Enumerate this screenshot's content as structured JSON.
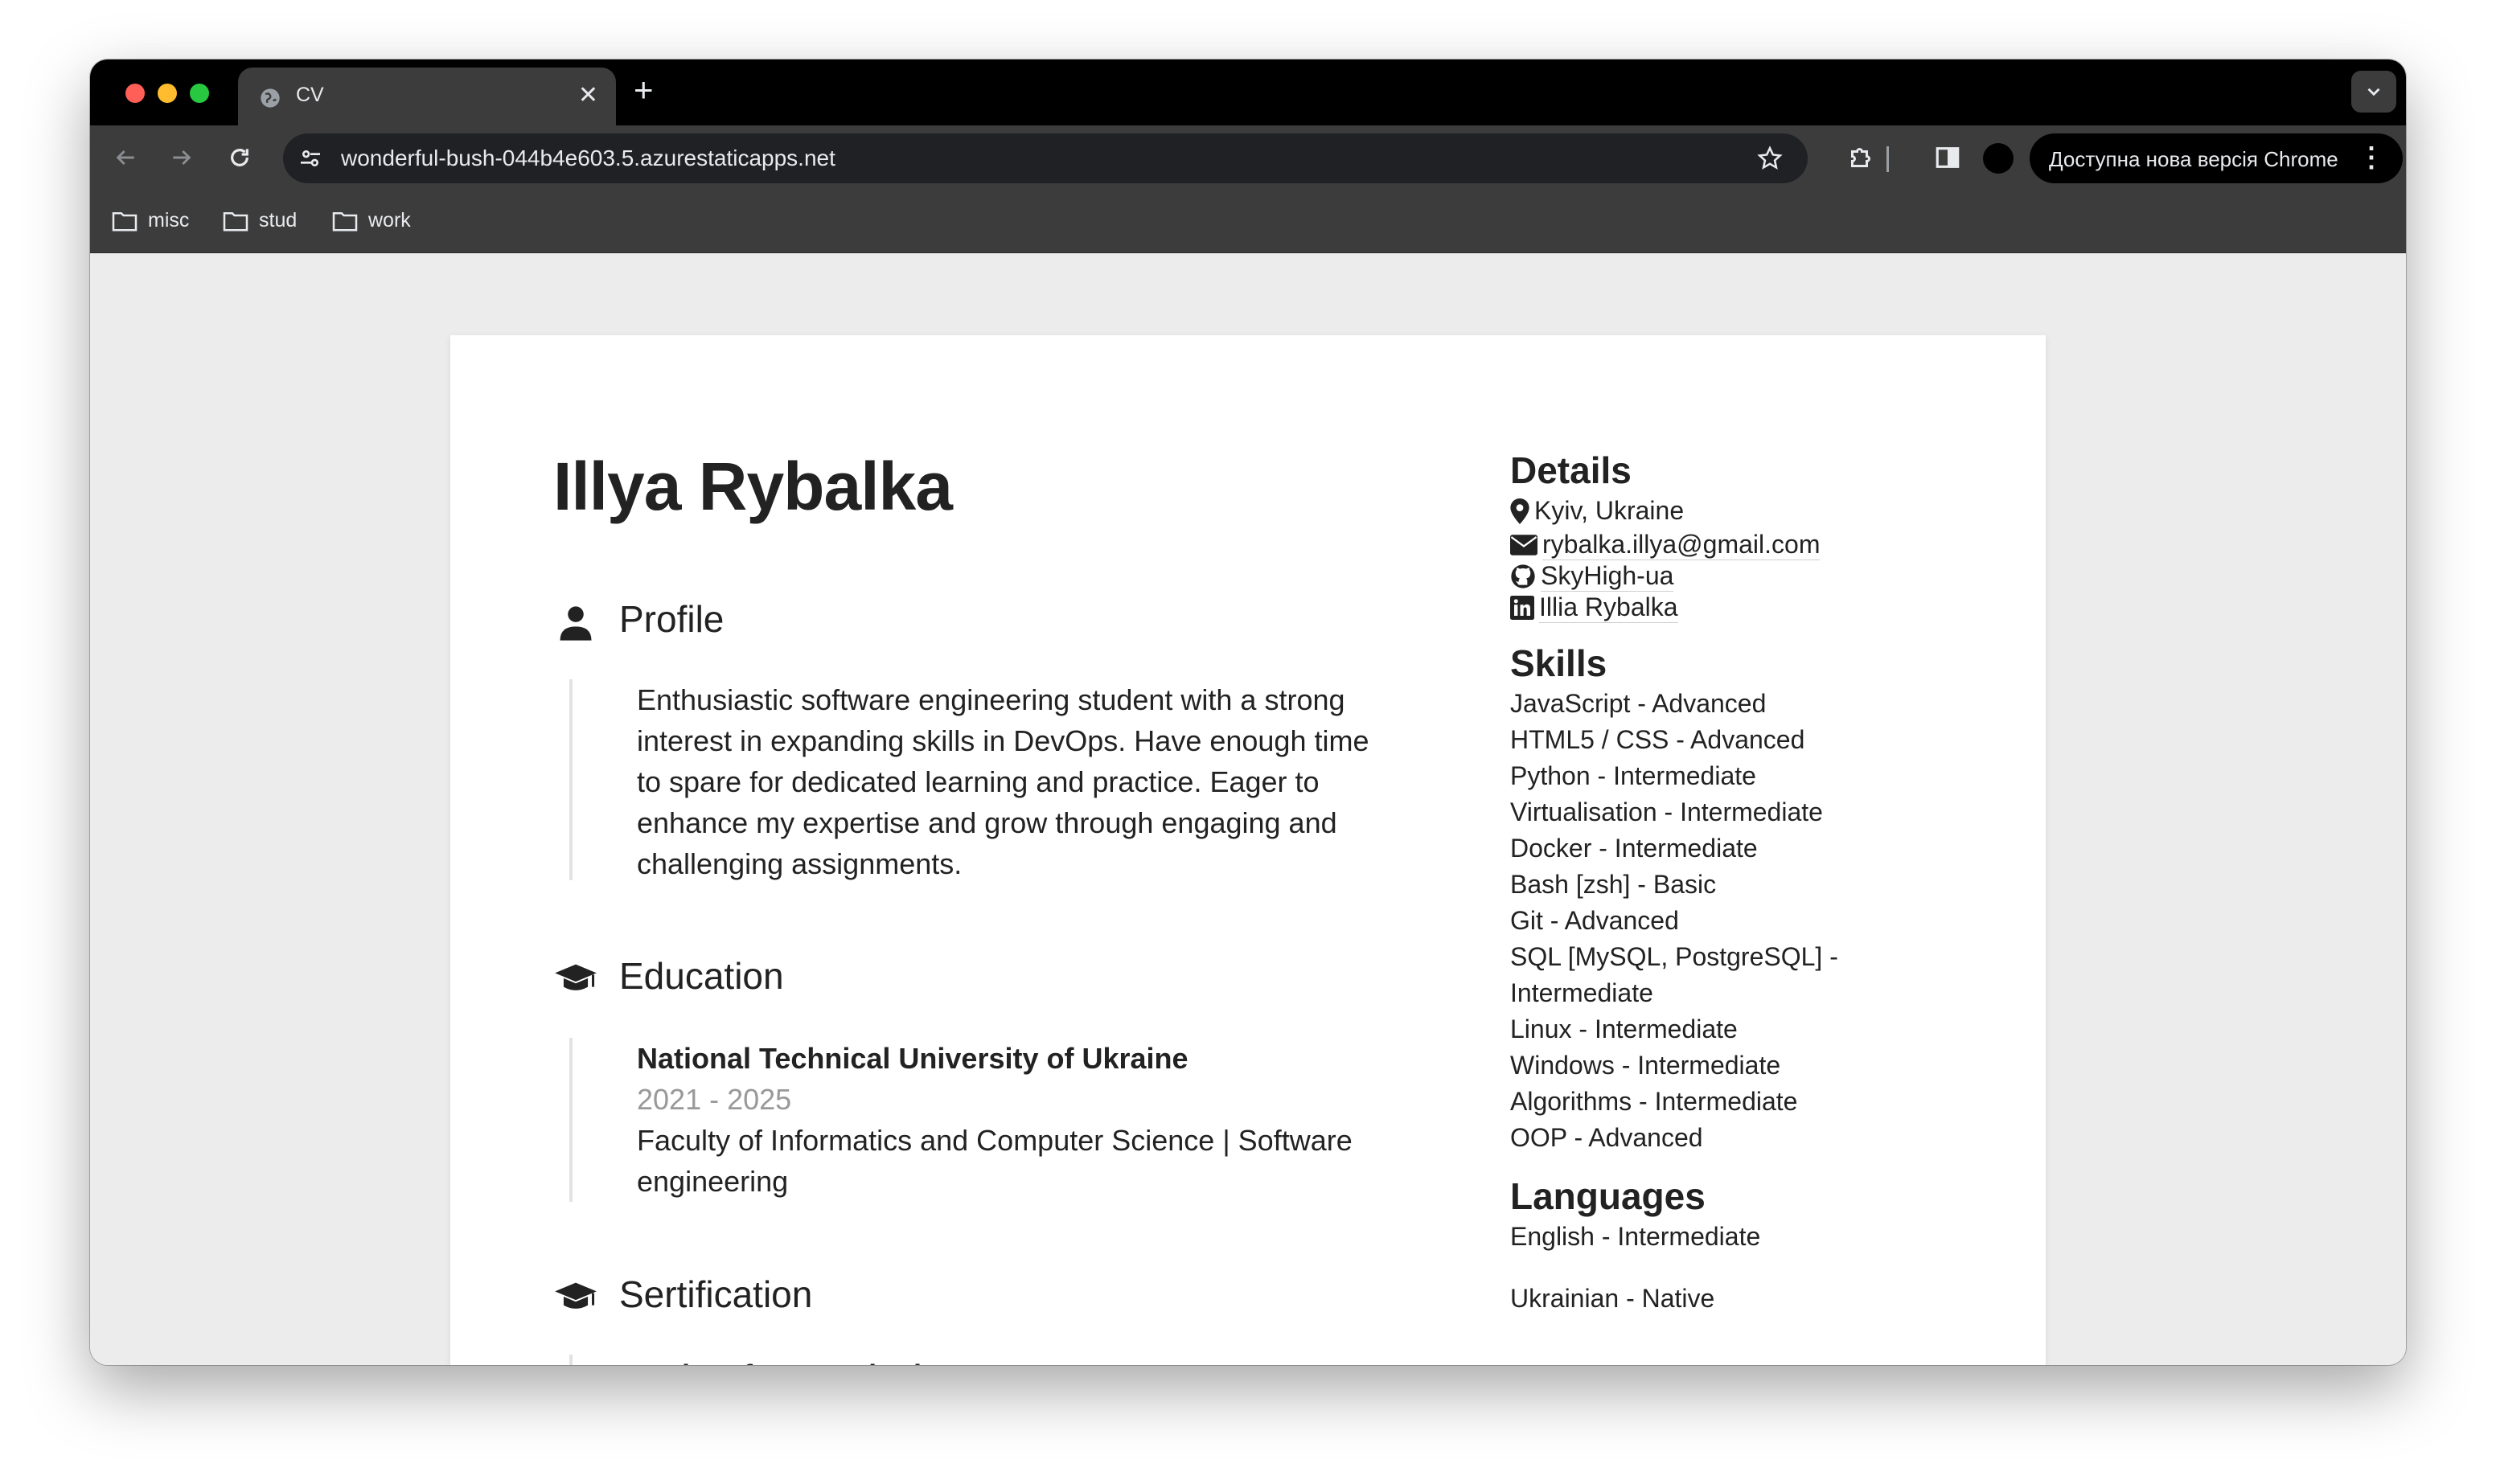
{
  "browser": {
    "tab_title": "CV",
    "new_tab_label": "+",
    "close_label": "✕",
    "url": "wonderful-bush-044b4e603.5.azurestaticapps.net",
    "update_label": "Доступна нова версія Chrome",
    "menu_label": "⋮",
    "bookmarks": [
      "misc",
      "stud",
      "work"
    ]
  },
  "cv": {
    "name": "Illya Rybalka",
    "profile": {
      "title": "Profile",
      "text": "Enthusiastic software engineering student with a strong interest in expanding skills in DevOps. Have enough time to spare for dedicated learning and practice. Eager to enhance my expertise and grow through engaging and challenging assignments."
    },
    "education": {
      "title": "Education",
      "school": "National Technical University of Ukraine",
      "years": "2021 - 2025",
      "faculty": "Faculty of Informatics and Computer Science | Software engineering"
    },
    "certification": {
      "title": "Sertification",
      "first_item": "Python for Everybody"
    },
    "details": {
      "title": "Details",
      "location": "Kyiv, Ukraine",
      "email": "rybalka.illya@gmail.com",
      "github": "SkyHigh-ua",
      "linkedin": "Illia Rybalka"
    },
    "skills": {
      "title": "Skills",
      "items": [
        "JavaScript - Advanced",
        "HTML5 / CSS - Advanced",
        "Python - Intermediate",
        "Virtualisation - Intermediate",
        "Docker - Intermediate",
        "Bash [zsh] - Basic",
        "Git - Advanced",
        "SQL [MySQL, PostgreSQL] - Intermediate",
        "Linux - Intermediate",
        "Windows - Intermediate",
        "Algorithms - Intermediate",
        "OOP - Advanced"
      ]
    },
    "languages": {
      "title": "Languages",
      "items": [
        "English - Intermediate",
        "Ukrainian - Native"
      ]
    }
  },
  "colors": {
    "tab_strip": "#000000",
    "toolbar": "#3c3c3c",
    "omnibox": "#202124",
    "page_bg": "#ececec",
    "paper": "#ffffff",
    "text": "#222222",
    "muted": "#999999"
  }
}
